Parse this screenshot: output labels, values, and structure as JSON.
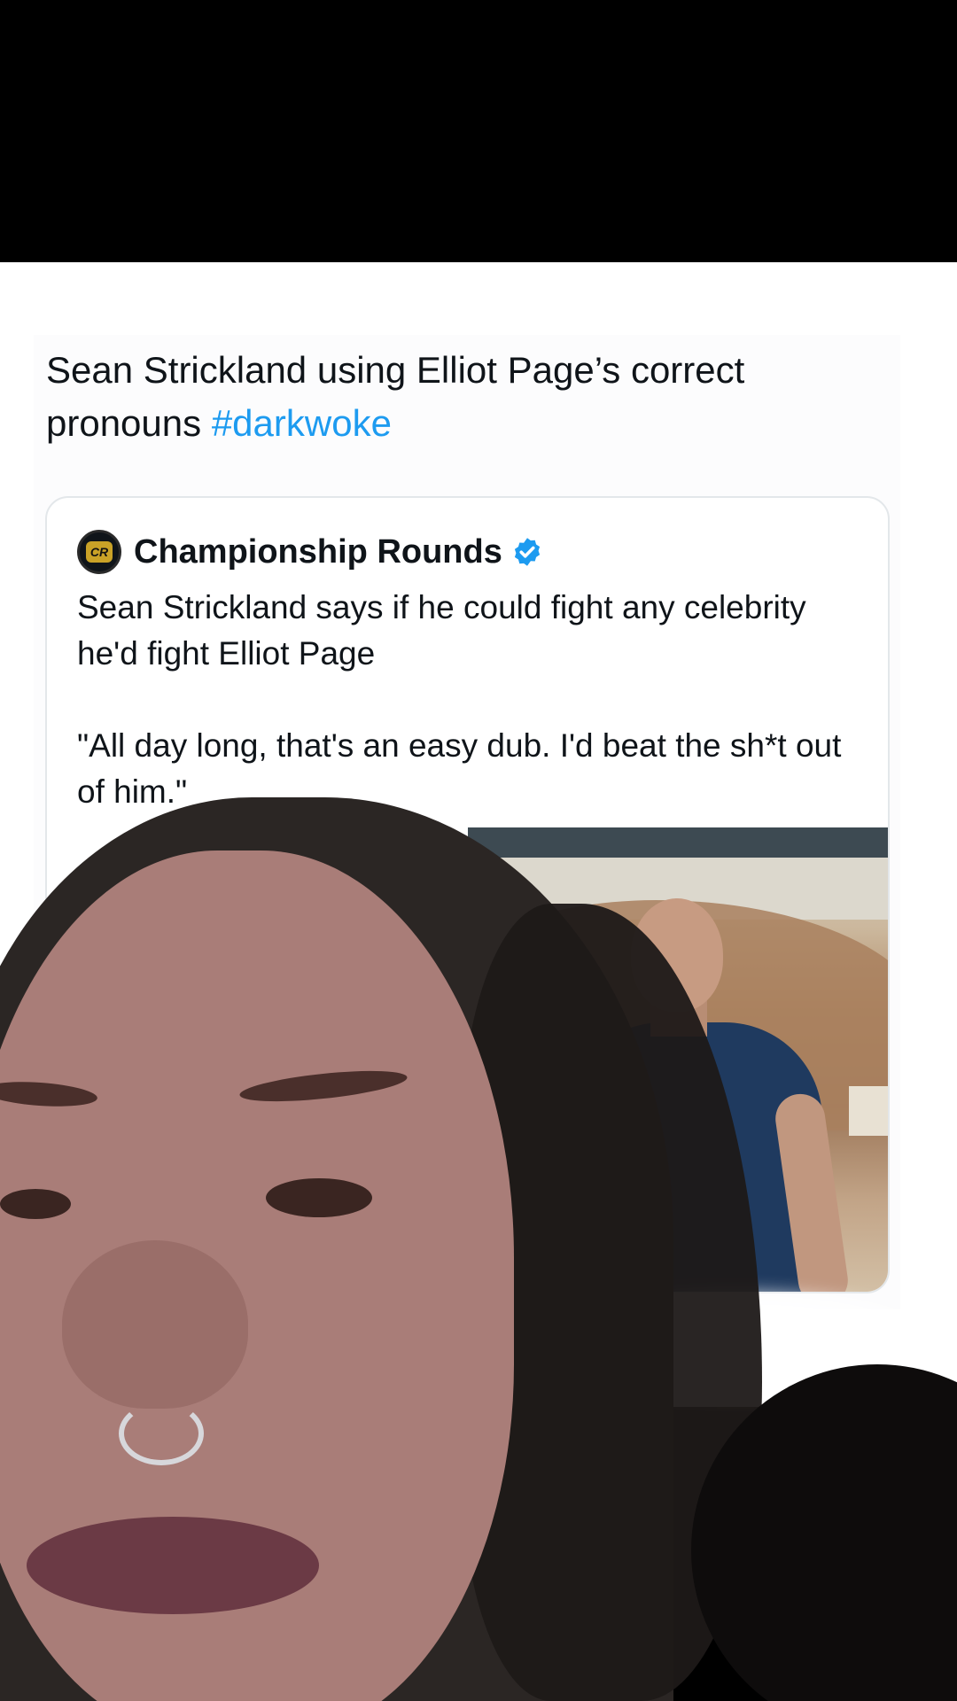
{
  "post": {
    "text_before_tag": "Sean Strickland using Elliot Page’s correct pronouns ",
    "hashtag": "#darkwoke"
  },
  "quoted_tweet": {
    "avatar_text": "CR",
    "author_name": "Championship Rounds",
    "verified_icon": "verified-badge-icon",
    "paragraph_1": "Sean Strickland says if he could fight any celebrity he'd fight Elliot Page",
    "paragraph_2": "\"All day long, that's an easy dub. I'd beat the sh*t out of him.\""
  },
  "colors": {
    "hashtag": "#1d9bf0",
    "verified": "#1d9bf0",
    "text": "#0f1419",
    "card_border": "#e3e7ea"
  }
}
